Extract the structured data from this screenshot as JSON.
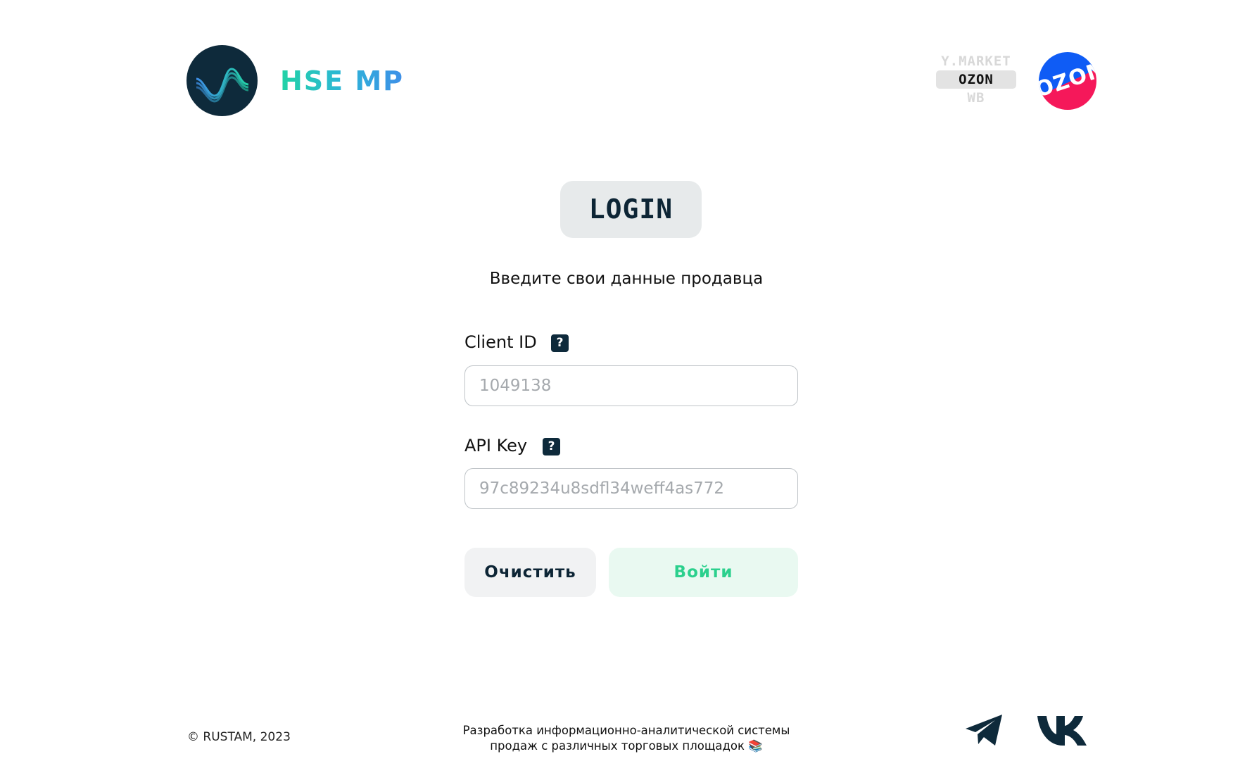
{
  "header": {
    "brand": "HSE MP",
    "marketplaces": [
      "Y.MARKET",
      "OZON",
      "WB"
    ],
    "active_marketplace": "OZON",
    "marketplace_logo_text": "OZON"
  },
  "login": {
    "badge": "LOGIN",
    "subtitle": "Введите свои данные продавца",
    "client_id": {
      "label": "Client ID",
      "help": "?",
      "value": "",
      "placeholder": "1049138"
    },
    "api_key": {
      "label": "API Key",
      "help": "?",
      "value": "",
      "placeholder": "97c89234u8sdfl34weff4as772"
    },
    "clear_label": "Очистить",
    "submit_label": "Войти"
  },
  "footer": {
    "copyright": "© RUSTAM, 2023",
    "description_line1": "Разработка информационно-аналитической системы",
    "description_line2": "продаж с различных торговых площадок 📚",
    "socials": [
      "telegram-icon",
      "vk-icon"
    ]
  },
  "colors": {
    "dark": "#0e2a3b",
    "brand_gradient": [
      "#22d3a5",
      "#3e8ee8"
    ],
    "login_button_text": "#2bd08d",
    "login_button_bg": "#e9f9f1",
    "ozon_blue": "#0f5cf5",
    "ozon_pink": "#f5185a"
  }
}
